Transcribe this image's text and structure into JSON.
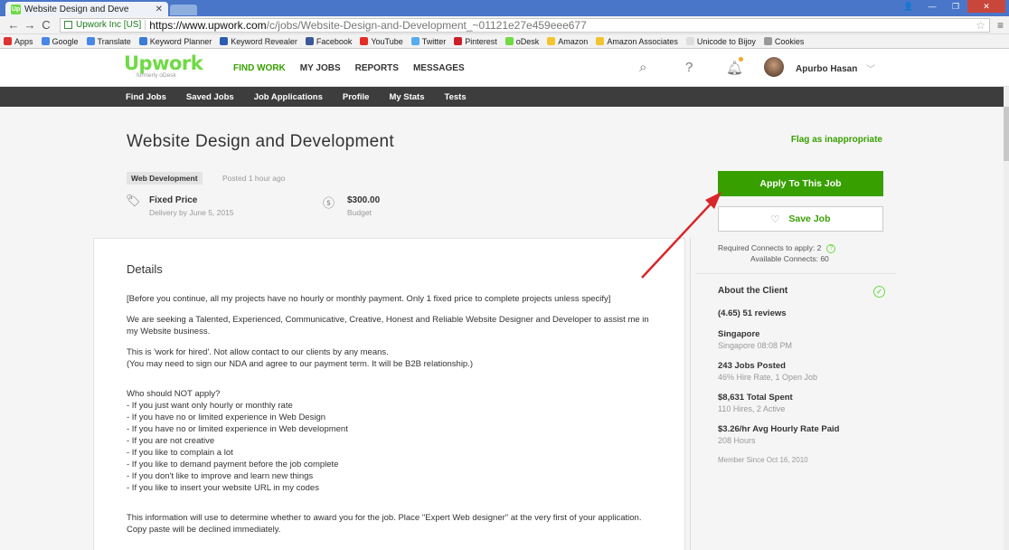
{
  "browser": {
    "tab_title": "Website Design and Deve",
    "tab_favicon": "Up",
    "secure_label": "Upwork Inc [US]",
    "url_host": "https://www.upwork.com",
    "url_path": "/c/jobs/Website-Design-and-Development_~01121e27e459eee677",
    "bookmarks": [
      "Apps",
      "Google",
      "Translate",
      "Keyword Planner",
      "Keyword Revealer",
      "Facebook",
      "YouTube",
      "Twitter",
      "Pinterest",
      "oDesk",
      "Amazon",
      "Amazon Associates",
      "Unicode to Bijoy",
      "Cookies"
    ]
  },
  "header": {
    "logo": "Upwork",
    "logo_sub": "formerly oDesk",
    "nav": [
      "FIND WORK",
      "MY JOBS",
      "REPORTS",
      "MESSAGES"
    ],
    "user_name": "Apurbo Hasan"
  },
  "subnav": [
    "Find Jobs",
    "Saved Jobs",
    "Job Applications",
    "Profile",
    "My Stats",
    "Tests"
  ],
  "job": {
    "title": "Website Design and Development",
    "flag_label": "Flag as inappropriate",
    "category": "Web Development",
    "posted": "Posted 1 hour ago",
    "type": "Fixed Price",
    "delivery": "Delivery by June 5, 2015",
    "budget": "$300.00",
    "budget_label": "Budget",
    "details_heading": "Details",
    "description": [
      "[Before you continue, all my projects have no hourly or monthly payment. Only 1 fixed price to complete projects unless specify]",
      "We are seeking a Talented, Experienced, Communicative, Creative, Honest and Reliable Website Designer and Developer to assist me in my Website business.",
      "This is 'work for hired'. Not allow contact to our clients by any means.\n(You may need to sign our NDA and agree to our payment term. It will be B2B relationship.)",
      "Who should NOT apply?\n- If you just want only hourly or monthly rate\n- If you have no or limited experience in Web Design\n- If you have no or limited experience in Web development\n- If you are not creative\n- If you like to complain a lot\n- If you like to demand payment before the job complete\n- If you don't like to improve and learn new things\n- If you like to insert your website URL in my codes",
      "This information will use to determine whether to award you for the job. Place \"Expert Web designer\" at the very first of your application. Copy paste will be declined immediately."
    ]
  },
  "sidebar": {
    "apply_label": "Apply To This Job",
    "save_label": "Save Job",
    "connects_required": "Required Connects to apply: 2",
    "connects_available": "Available Connects: 60",
    "client_heading": "About the Client",
    "reviews": "(4.65) 51 reviews",
    "location": "Singapore",
    "local_time": "Singapore 08:08 PM",
    "jobs_posted": "243 Jobs Posted",
    "hire_rate": "46% Hire Rate, 1 Open Job",
    "total_spent": "$8,631 Total Spent",
    "hires": "110 Hires, 2 Active",
    "avg_rate": "$3.26/hr Avg Hourly Rate Paid",
    "hours": "208 Hours",
    "member_since": "Member Since Oct 16, 2010"
  },
  "colors": {
    "accent": "#37a000",
    "brand": "#6fda44",
    "subnav": "#3d3d3d",
    "annotation_arrow": "#d9262a"
  }
}
